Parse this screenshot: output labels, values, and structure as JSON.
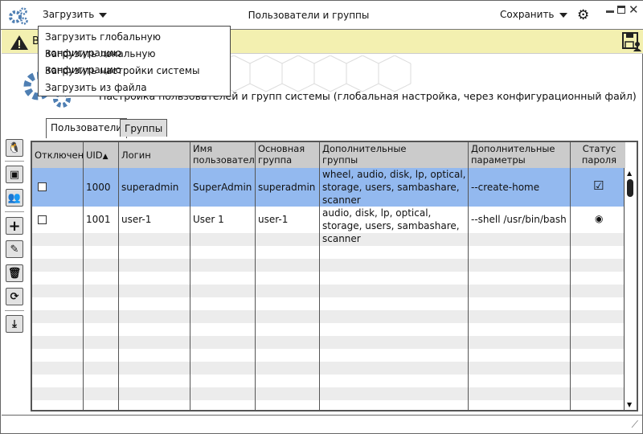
{
  "titlebar": {
    "load_label": "Загрузить",
    "title": "Пользователи и группы",
    "save_label": "Сохранить"
  },
  "load_menu": [
    "Загрузить глобальную конфигурацию",
    "Загрузить локальную конфигурацию",
    "Загрузить настройки системы",
    "Загрузить из файла"
  ],
  "banner": {
    "text": "В"
  },
  "subtitle": "Настройка пользователей и групп системы (глобальная настройка, через конфигурационный файл)",
  "tabs": [
    {
      "label": "Пользователи",
      "active": true
    },
    {
      "label": "Группы",
      "active": false
    }
  ],
  "table": {
    "headers": [
      "Отключен",
      "UID",
      "Логин",
      "Имя пользователя",
      "Основная группа",
      "Дополнительные группы",
      "Дополнительные параметры",
      "Статус пароля"
    ],
    "sort": {
      "column": "UID",
      "direction": "asc"
    },
    "rows": [
      {
        "disabled": false,
        "uid": "1000",
        "login": "superadmin",
        "name": "SuperAdmin",
        "group": "superadmin",
        "extra_groups": "wheel, audio, disk, lp, optical, storage, users, sambashare, scanner",
        "params": "--create-home",
        "password_status": "checked",
        "selected": true
      },
      {
        "disabled": false,
        "uid": "1001",
        "login": "user-1",
        "name": "User 1",
        "group": "user-1",
        "extra_groups": "audio, disk, lp, optical, storage, users, sambashare, scanner",
        "params": "--shell /usr/bin/bash",
        "password_status": "radio",
        "selected": false
      }
    ]
  },
  "sidebar_icons": [
    "linux-icon",
    "user-card-icon",
    "users-group-icon",
    "plus-icon",
    "edit-icon",
    "trash-icon",
    "refresh-icon",
    "download-icon"
  ],
  "colors": {
    "selected_row": "#93b9ef",
    "banner": "#f3f0b0",
    "accent": "#4f7fb3",
    "header": "#cbcbcb"
  }
}
